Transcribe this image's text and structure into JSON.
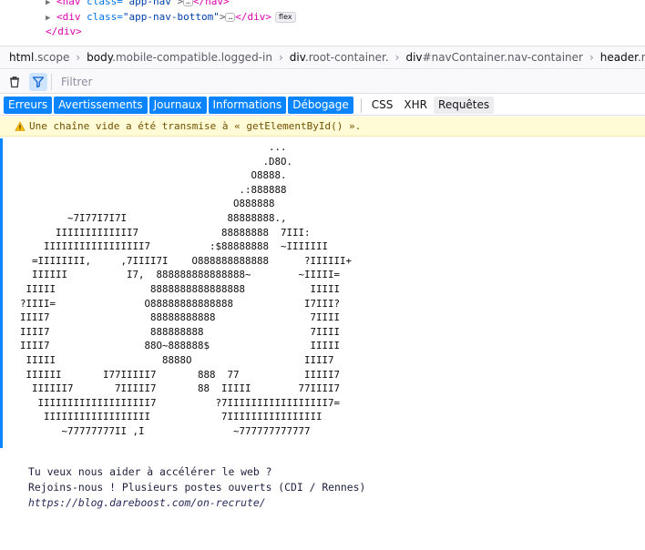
{
  "dom_tree": {
    "line1": {
      "tag_open": "<nav ",
      "attr": "class=",
      "value": "\"app-nav\"",
      "close": "></nav>"
    },
    "line2": {
      "tag_open": "<div ",
      "attr": "class=",
      "value": "\"app-nav-bottom\"",
      "close": "></div>",
      "badge": "flex"
    },
    "line3": {
      "text": "</div>"
    }
  },
  "breadcrumbs": [
    {
      "element": "html",
      "classes": ".scope"
    },
    {
      "element": "body",
      "classes": ".mobile-compatible.logged-in"
    },
    {
      "element": "div",
      "classes": ".root-container."
    },
    {
      "element": "div",
      "classes": "#navContainer.nav-container"
    },
    {
      "element": "header",
      "classes": ".nav-header"
    }
  ],
  "toolbar": {
    "filter_placeholder": "Filtrer",
    "icons": [
      "trash-icon",
      "filter-icon"
    ]
  },
  "categories_active": [
    "Erreurs",
    "Avertissements",
    "Journaux",
    "Informations",
    "Débogage"
  ],
  "categories_inactive": [
    "CSS",
    "XHR",
    "Requêtes"
  ],
  "warning": {
    "icon": "warning-icon",
    "text": "Une chaîne vide a été transmise à « getElementById() »."
  },
  "ascii_art": "                                          ...\n                                         .D8O.\n                                       O8888.\n                                     .:888888\n                                    O888888\n        ~7I77I7I7I                 88888888.,\n      IIIIIIIIIIIII7              88888888  7III:\n    IIIIIIIIIIIIIIIII7          :$88888888  ~IIIIIII\n  =IIIIIIII,     ,7IIII7I    O888888888888      ?IIIIII+\n  IIIIII          I7,  888888888888888~        ~IIIII=\n IIIII                8888888888888888           IIIII\n?IIII=               O88888888888888            I7III?\nIIII7                 88888888888                7IIII\nIIII7                 888888888                  7IIII\nIIII7                88O~888888$                 IIIII\n IIIII                  8888O                   IIII7\n IIIIII       I77IIIII7       888  77           IIIII7\n  IIIIII7       7IIIII7       88  IIIII        77IIII7\n   IIIIIIIIIIIIIIIIIII7          ?7IIIIIIIIIIIIIIIII7=\n    IIIIIIIIIIIIIIIIII            7IIIIIIIIIIIIIIII\n       ~77777777II ,I               ~777777777777",
  "message": {
    "line1": "Tu veux nous aider à accélérer le web ?",
    "line2": "Rejoins-nous ! Plusieurs postes ouverts (CDI / Rennes)",
    "link": "https://blog.dareboost.com/on-recrute/"
  },
  "colors": {
    "accent": "#0a84ff",
    "warning_bg": "#fffbd6",
    "warning_text": "#715100"
  }
}
